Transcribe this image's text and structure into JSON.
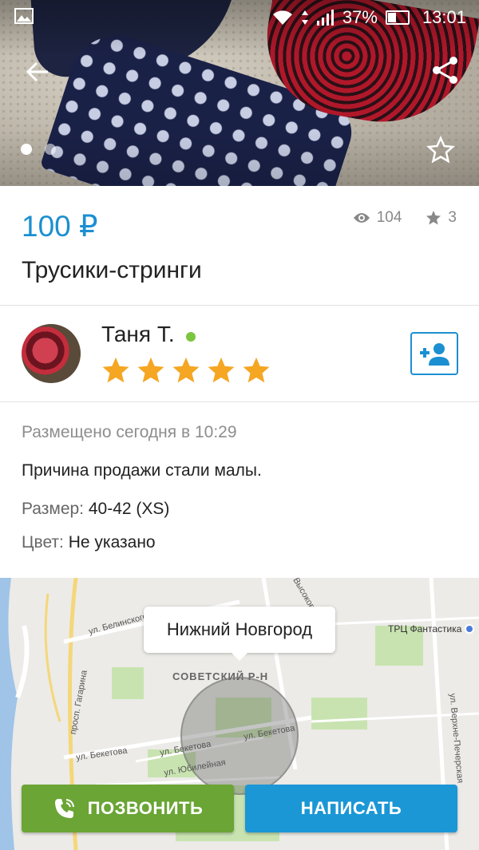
{
  "status_bar": {
    "battery": "37%",
    "time": "13:01"
  },
  "listing": {
    "price": "100 ₽",
    "views": "104",
    "favorites": "3",
    "title": "Трусики-стринги",
    "gallery_count": 2,
    "gallery_active": 1
  },
  "seller": {
    "name": "Таня Т.",
    "rating": 5,
    "online": true
  },
  "details": {
    "posted": "Размещено сегодня в 10:29",
    "reason": "Причина продажи стали малы.",
    "size_label": "Размер:",
    "size_value": "40-42 (XS)",
    "color_label": "Цвет:",
    "color_value": "Не указано"
  },
  "map": {
    "city": "Нижний Новгород",
    "district": "СОВЕТСКИЙ Р-Н",
    "mall": "ТРЦ Фантастика",
    "streets": [
      "ул. Белинского",
      "просп. Гагарина",
      "ул. Бекетова",
      "ул. Бекетова",
      "ул. Бекетова",
      "ул. Юбилейная",
      "Высоковс...",
      "ул. Верхне-Печерская"
    ]
  },
  "actions": {
    "call_label": "ПОЗВОНИТЬ",
    "write_label": "НАПИСАТЬ"
  },
  "colors": {
    "accent": "#1b8fd1",
    "call": "#6aa535",
    "write": "#1b97d6",
    "star": "#f5a623",
    "online": "#7cc540"
  }
}
